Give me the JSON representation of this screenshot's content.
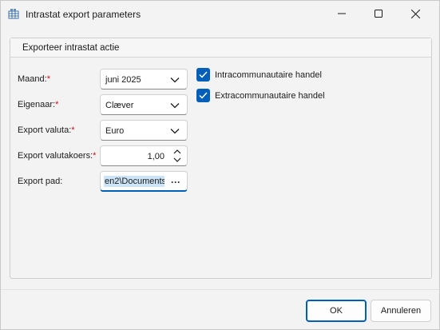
{
  "window": {
    "title": "Intrastat export parameters",
    "icon": "table-grid-icon"
  },
  "group": {
    "title": "Exporteer intrastat actie"
  },
  "form": {
    "maand": {
      "label": "Maand:",
      "required_mark": "*",
      "value": "juni 2025"
    },
    "eigenaar": {
      "label": "Eigenaar:",
      "required_mark": "*",
      "value": "Clæver"
    },
    "export_valuta": {
      "label": "Export valuta:",
      "required_mark": "*",
      "value": "Euro"
    },
    "export_valutakoers": {
      "label": "Export valutakoers:",
      "required_mark": "*",
      "value": "1,00"
    },
    "export_pad": {
      "label": "Export pad:",
      "value": "en2\\Documents",
      "browse_label": "···"
    }
  },
  "checkboxes": [
    {
      "label": "Intracommunautaire handel",
      "checked": true
    },
    {
      "label": "Extracommunautaire handel",
      "checked": true
    }
  ],
  "buttons": {
    "ok": "OK",
    "cancel": "Annuleren"
  },
  "colors": {
    "accent": "#005fb8",
    "required": "#c50f1f",
    "selection": "#cce4f7"
  }
}
